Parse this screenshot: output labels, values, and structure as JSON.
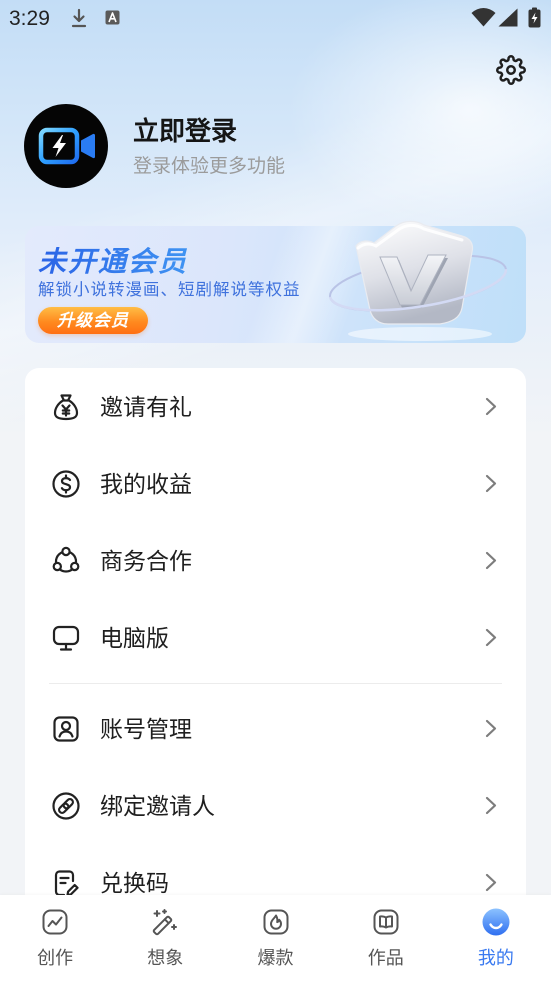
{
  "status_bar": {
    "time": "3:29",
    "left_icons": [
      "download-icon",
      "a-notification-icon"
    ],
    "right_icons": [
      "wifi-icon",
      "signal-icon",
      "battery-charging-icon"
    ]
  },
  "header": {
    "settings_icon": "gear-icon"
  },
  "profile": {
    "avatar_icon": "video-lightning-icon",
    "title": "立即登录",
    "subtitle": "登录体验更多功能"
  },
  "vip_banner": {
    "title": "未开通会员",
    "subtitle": "解锁小说转漫画、短剧解说等权益",
    "button_label": "升级会员",
    "badge_icon": "crown-v-icon"
  },
  "menu": {
    "groups": [
      {
        "items": [
          {
            "label": "邀请有礼",
            "icon": "money-bag-yen-icon"
          },
          {
            "label": "我的收益",
            "icon": "dollar-circle-icon"
          },
          {
            "label": "商务合作",
            "icon": "collaboration-icon"
          },
          {
            "label": "电脑版",
            "icon": "monitor-icon"
          }
        ]
      },
      {
        "items": [
          {
            "label": "账号管理",
            "icon": "user-square-icon"
          },
          {
            "label": "绑定邀请人",
            "icon": "link-circle-icon"
          },
          {
            "label": "兑换码",
            "icon": "redeem-code-icon"
          }
        ]
      }
    ],
    "row_trailing_icon": "chevron-right-icon"
  },
  "bottom_nav": {
    "tabs": [
      {
        "label": "创作",
        "icon": "chart-square-icon",
        "active": false
      },
      {
        "label": "想象",
        "icon": "magic-wand-icon",
        "active": false
      },
      {
        "label": "爆款",
        "icon": "flame-square-icon",
        "active": false
      },
      {
        "label": "作品",
        "icon": "book-square-icon",
        "active": false
      },
      {
        "label": "我的",
        "icon": "smile-circle-icon",
        "active": true
      }
    ]
  },
  "colors": {
    "accent": "#3a7af0",
    "vip_title": "#2f6be6",
    "vip_button": "#ff8a1f",
    "text_primary": "#1f1f1f",
    "text_secondary": "#9a9a9a",
    "page_background": "#f2f4f7"
  }
}
